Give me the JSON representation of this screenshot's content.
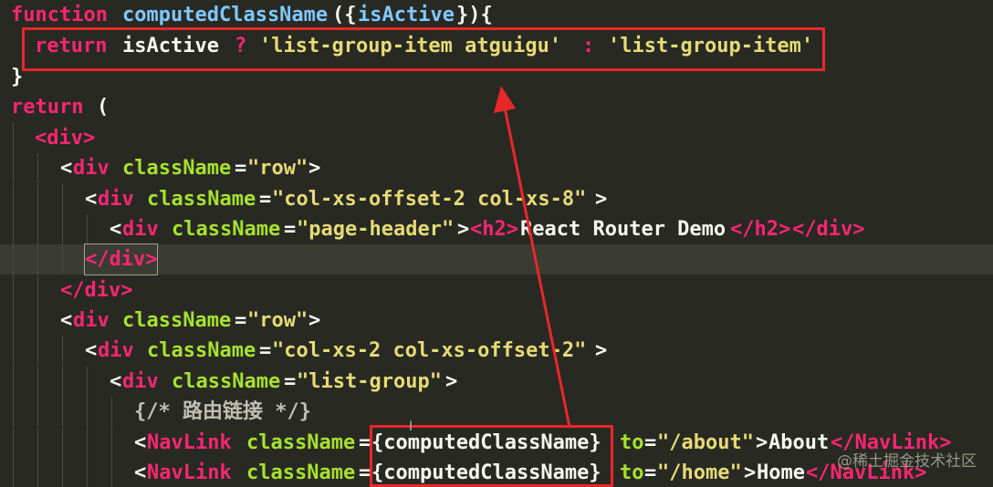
{
  "code": {
    "l1": {
      "kw": "function",
      "name": "computedClassName",
      "open": "({",
      "param": "isActive",
      "close": "}){"
    },
    "l2": {
      "kw": "return",
      "ident": "isActive",
      "op1": "?",
      "str1": "'list-group-item atguigu'",
      "op2": ":",
      "str2": "'list-group-item'"
    },
    "l3": {
      "close": "}"
    },
    "l4": {
      "kw": "return",
      "paren": "("
    },
    "l5": {
      "tag": "<div>"
    },
    "l6": {
      "lt": "<",
      "tag": "div",
      "attr": "className",
      "eq": "=",
      "val": "\"row\"",
      "gt": ">"
    },
    "l7": {
      "lt": "<",
      "tag": "div",
      "attr": "className",
      "eq": "=",
      "val": "\"col-xs-offset-2 col-xs-8\"",
      "gt": ">"
    },
    "l8": {
      "lt": "<",
      "tag": "div",
      "attr": "className",
      "eq": "=",
      "val": "\"page-header\"",
      "gt": ">",
      "h2open": "<h2>",
      "text": "React Router Demo",
      "h2close": "</h2>",
      "divclose": "</div>"
    },
    "l9": {
      "close": "</div>"
    },
    "l10": {
      "close": "</div>"
    },
    "l11": {
      "lt": "<",
      "tag": "div",
      "attr": "className",
      "eq": "=",
      "val": "\"row\"",
      "gt": ">"
    },
    "l12": {
      "lt": "<",
      "tag": "div",
      "attr": "className",
      "eq": "=",
      "val": "\"col-xs-2 col-xs-offset-2\"",
      "gt": ">"
    },
    "l13": {
      "lt": "<",
      "tag": "div",
      "attr": "className",
      "eq": "=",
      "val": "\"list-group\"",
      "gt": ">"
    },
    "l14": {
      "comment": "{/* 路由链接 */}"
    },
    "l15": {
      "lt": "<",
      "tag": "NavLink",
      "attr": "className",
      "eq": "=",
      "expr": "{computedClassName}",
      "attr2": "to",
      "eq2": "=",
      "val2": "\"/about\"",
      "gt": ">",
      "text": "About",
      "closetag": "</NavLink>"
    },
    "l16": {
      "lt": "<",
      "tag": "NavLink",
      "attr": "className",
      "eq": "=",
      "expr": "{computedClassName}",
      "attr2": "to",
      "eq2": "=",
      "val2": "\"/home\"",
      "gt": ">",
      "text": "Home",
      "closetag": "</NavLink>"
    }
  },
  "watermark": "@稀土掘金技术社区",
  "annotation_color": "#e8272b"
}
